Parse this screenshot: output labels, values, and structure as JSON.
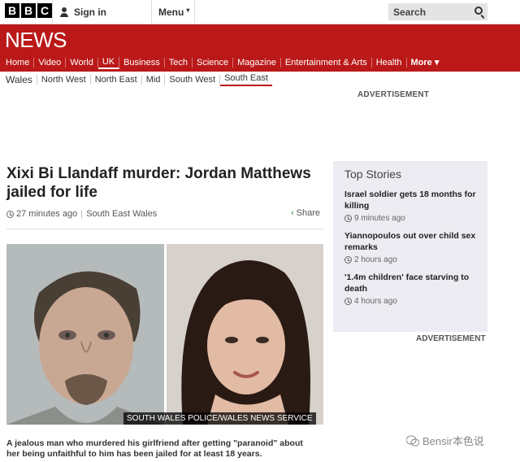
{
  "topbar": {
    "logo_letters": [
      "B",
      "B",
      "C"
    ],
    "signin_label": "Sign in",
    "menu_label": "Menu",
    "search_placeholder": "Search"
  },
  "masthead": {
    "brand": "NEWS",
    "nav": [
      "Home",
      "Video",
      "World",
      "UK",
      "Business",
      "Tech",
      "Science",
      "Magazine",
      "Entertainment & Arts",
      "Health",
      "More"
    ],
    "active_nav": "UK"
  },
  "subnav": {
    "items": [
      "Wales",
      "North West",
      "North East",
      "Mid",
      "South West",
      "South East"
    ],
    "active": "South East"
  },
  "ad_label": "ADVERTISEMENT",
  "article": {
    "headline": "Xixi Bi Llandaff murder: Jordan Matthews jailed for life",
    "time": "27 minutes ago",
    "section": "South East Wales",
    "share_label": "Share",
    "photo_caption": "SOUTH WALES POLICE/WALES NEWS SERVICE",
    "intro": "A jealous man who murdered his girlfriend after getting \"paranoid\" about her being unfaithful to him has been jailed for at least 18 years."
  },
  "top_stories": {
    "title": "Top Stories",
    "items": [
      {
        "title": "Israel soldier gets 18 months for killing",
        "time": "9 minutes ago"
      },
      {
        "title": "Yiannopoulos out over child sex remarks",
        "time": "2 hours ago"
      },
      {
        "title": "'1.4m children' face starving to death",
        "time": "4 hours ago"
      }
    ]
  },
  "sidebar_ad_label": "ADVERTISEMENT",
  "watermark": "Bensir本色说",
  "colors": {
    "brand_red": "#bb1919",
    "share_green": "#2b8a3e"
  }
}
